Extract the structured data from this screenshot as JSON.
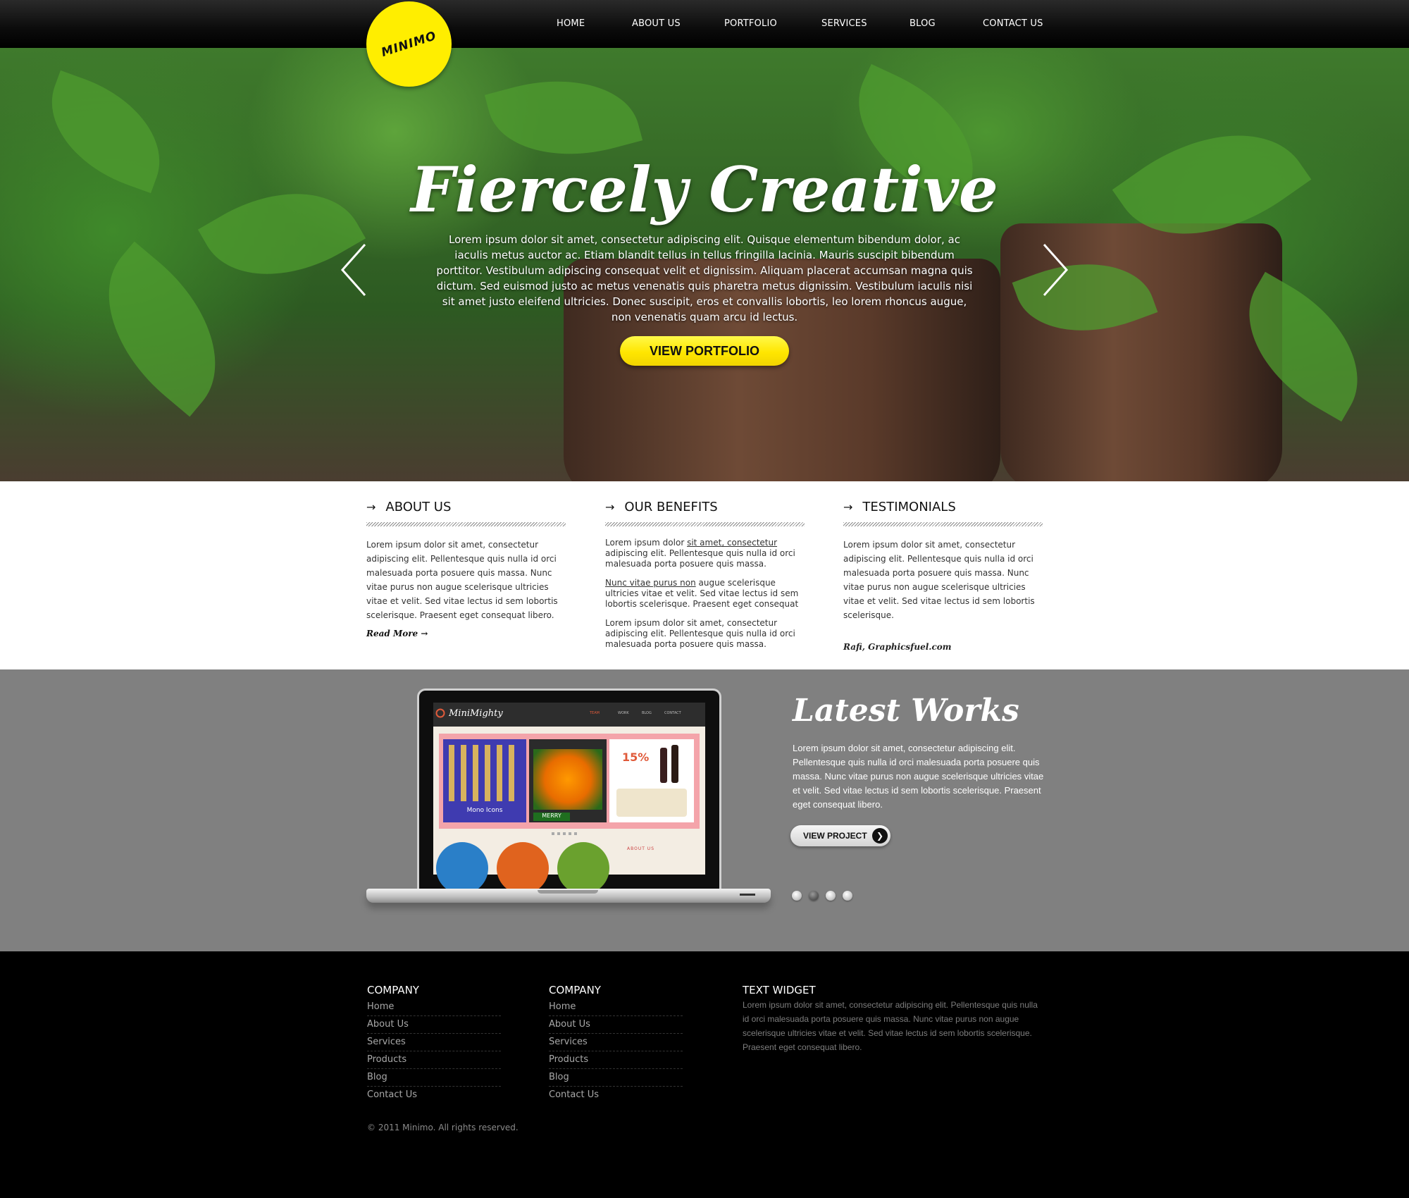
{
  "brand": {
    "logo_text": "MINIMO",
    "accent": "#ffee00"
  },
  "nav": {
    "items": [
      {
        "label": "HOME"
      },
      {
        "label": "ABOUT US"
      },
      {
        "label": "PORTFOLIO"
      },
      {
        "label": "SERVICES"
      },
      {
        "label": "BLOG"
      },
      {
        "label": "CONTACT US"
      }
    ]
  },
  "hero": {
    "title": "Fiercely Creative",
    "text": "Lorem ipsum dolor sit amet, consectetur adipiscing elit. Quisque elementum bibendum dolor, ac iaculis metus auctor ac. Etiam blandit tellus in tellus fringilla lacinia. Mauris suscipit bibendum porttitor. Vestibulum adipiscing consequat velit et dignissim. Aliquam placerat accumsan magna quis dictum. Sed euismod justo ac metus venenatis quis pharetra metus dignissim. Vestibulum iaculis nisi sit amet justo eleifend ultricies. Donec suscipit, eros et convallis lobortis, leo lorem rhoncus augue, non venenatis quam arcu id lectus.",
    "button": "VIEW PORTFOLIO",
    "prev_icon": "chevron-left-icon",
    "next_icon": "chevron-right-icon"
  },
  "about": {
    "heading": "ABOUT US",
    "text": "Lorem ipsum dolor sit amet, consectetur adipiscing elit. Pellentesque quis nulla id orci malesuada porta posuere quis massa. Nunc vitae purus non augue scelerisque ultricies vitae et velit. Sed vitae lectus id sem lobortis scelerisque. Praesent eget consequat libero.",
    "read_more": "Read More"
  },
  "benefits": {
    "heading": "OUR BENEFITS",
    "p1_pre": "Lorem ipsum dolor ",
    "p1_link": "sit amet, consectetur",
    "p1_post": " adipiscing elit. Pellentesque quis nulla id orci malesuada porta posuere quis massa.",
    "p2_link": "Nunc vitae purus non",
    "p2_post": " augue scelerisque ultricies vitae et velit. Sed vitae lectus id sem lobortis scelerisque. Praesent eget consequat",
    "p3": "Lorem ipsum dolor sit amet, consectetur adipiscing elit. Pellentesque quis nulla id orci malesuada porta posuere quis massa."
  },
  "testimonials": {
    "heading": "TESTIMONIALS",
    "text": "Lorem ipsum dolor sit amet, consectetur adipiscing elit. Pellentesque quis nulla id orci malesuada porta posuere quis massa. Nunc vitae purus non augue scelerisque ultricies vitae et velit. Sed vitae lectus id sem lobortis scelerisque.",
    "signature": "Rafi, Graphicsfuel.com"
  },
  "works": {
    "title": "Latest Works",
    "text": "Lorem ipsum dolor sit amet, consectetur adipiscing elit. Pellentesque quis nulla id orci malesuada porta posuere quis massa. Nunc vitae purus non augue scelerisque ultricies vitae et velit. Sed vitae lectus id sem lobortis scelerisque. Praesent eget consequat libero.",
    "button": "VIEW PROJECT",
    "pager_active": 2,
    "pager_count": 4,
    "mock": {
      "site_name": "MiniMighty",
      "nav": [
        "TEAM",
        "WORK",
        "BLOG",
        "CONTACT"
      ],
      "panel1_caption": "Mono Icons",
      "panel2_caption": "MERRY",
      "panel3_badge": "15%",
      "section_label": "ABOUT US"
    }
  },
  "footer": {
    "col1": {
      "heading": "COMPANY",
      "links": [
        "Home",
        "About Us",
        "Services",
        "Products",
        "Blog",
        "Contact Us"
      ]
    },
    "col2": {
      "heading": "COMPANY",
      "links": [
        "Home",
        "About Us",
        "Services",
        "Products",
        "Blog",
        "Contact Us"
      ]
    },
    "widget": {
      "heading": "TEXT WIDGET",
      "text": "Lorem ipsum dolor sit amet, consectetur adipiscing elit. Pellentesque quis nulla id orci malesuada porta posuere quis massa. Nunc vitae purus non augue scelerisque ultricies vitae et velit. Sed vitae lectus id sem lobortis scelerisque. Praesent eget consequat libero."
    },
    "copyright": "© 2011 Minimo. All rights reserved."
  }
}
